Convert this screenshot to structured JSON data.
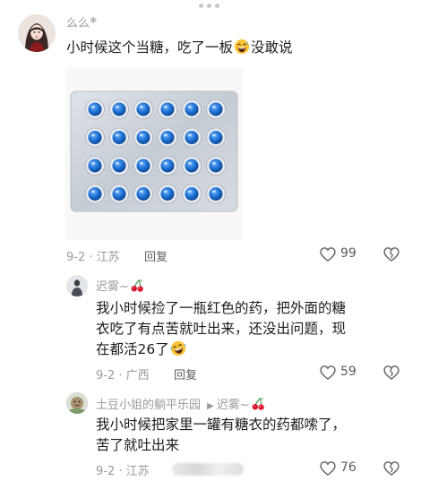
{
  "comments": [
    {
      "username": "么么",
      "text_before_emoji": "小时候这个当糖，吃了一板",
      "emoji": "grinning-sweat-emoji",
      "text_after_emoji": "没敢说",
      "date": "9-2",
      "location": "江苏",
      "reply_label": "回复",
      "like_count": "99",
      "has_image": true
    },
    {
      "username": "迟雾~",
      "name_emoji": "cherries-emoji",
      "text_lines": [
        "我小时候捡了一瓶红色的药，把外面的糖",
        "衣吃了有点苦就吐出来，还没出问题，现",
        "在都活26了"
      ],
      "emoji": "rofl-emoji",
      "date": "9-2",
      "location": "广西",
      "reply_label": "回复",
      "like_count": "59"
    },
    {
      "username": "土豆小姐的躺平乐园",
      "reply_to": "迟雾~",
      "name_emoji": "cherries-emoji",
      "text_lines": [
        "我小时候把家里一罐有糖衣的药都嗦了，",
        "苦了就吐出来"
      ],
      "date": "9-2",
      "location": "江苏",
      "like_count": "76"
    }
  ],
  "colors": {
    "pill_blue": "#1a6fd0",
    "blister_silver": "#c9ced6",
    "meta_gray": "#9a9a9a"
  }
}
